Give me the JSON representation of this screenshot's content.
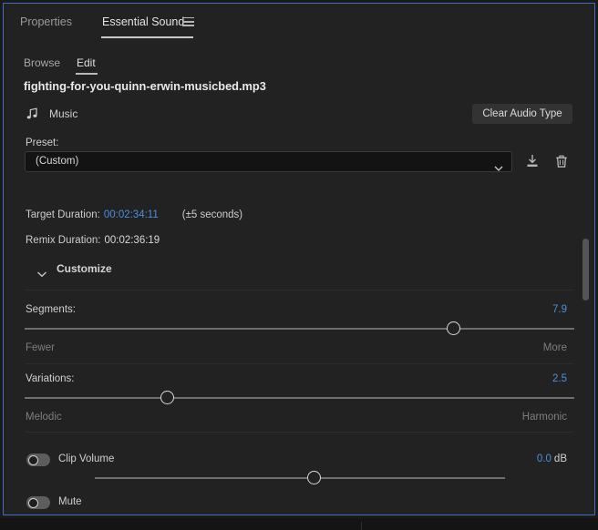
{
  "panel": {
    "tabs": [
      {
        "label": "Properties",
        "active": false
      },
      {
        "label": "Essential Sound",
        "active": true
      }
    ],
    "menu_icon": "hamburger-menu-icon",
    "subtabs": [
      {
        "label": "Browse",
        "active": false
      },
      {
        "label": "Edit",
        "active": true
      }
    ]
  },
  "file": {
    "name": "fighting-for-you-quinn-erwin-musicbed.mp3"
  },
  "audio_type": {
    "icon": "music-note-icon",
    "label": "Music",
    "clear_button": "Clear Audio Type"
  },
  "preset": {
    "label": "Preset:",
    "value": "(Custom)",
    "options": [
      "(Custom)"
    ],
    "chevron_icon": "chevron-down-icon",
    "save_icon": "save-preset-icon",
    "delete_icon": "trash-icon"
  },
  "duration": {
    "target_label": "Target Duration:",
    "target_value": "00:02:34:11",
    "tolerance": "(±5 seconds)",
    "remix_label": "Remix Duration:",
    "remix_value": "00:02:36:19"
  },
  "customize": {
    "label": "Customize",
    "chevron_icon": "chevron-down-icon",
    "expanded": true
  },
  "sliders": [
    {
      "name": "Segments:",
      "value": "7.9",
      "min_label": "Fewer",
      "max_label": "More",
      "percent": 78
    },
    {
      "name": "Variations:",
      "value": "2.5",
      "min_label": "Melodic",
      "max_label": "Harmonic",
      "percent": 26
    }
  ],
  "clip_volume": {
    "label": "Clip Volume",
    "value": "0.0",
    "unit": "dB",
    "enabled": false
  },
  "mute": {
    "label": "Mute",
    "enabled": false
  },
  "colors": {
    "panel_background": "#222222",
    "panel_border": "#3b6fc4",
    "accent_blue": "#4a8fe0",
    "text_primary": "#d8d8d8",
    "text_muted": "#7e7e7e"
  }
}
